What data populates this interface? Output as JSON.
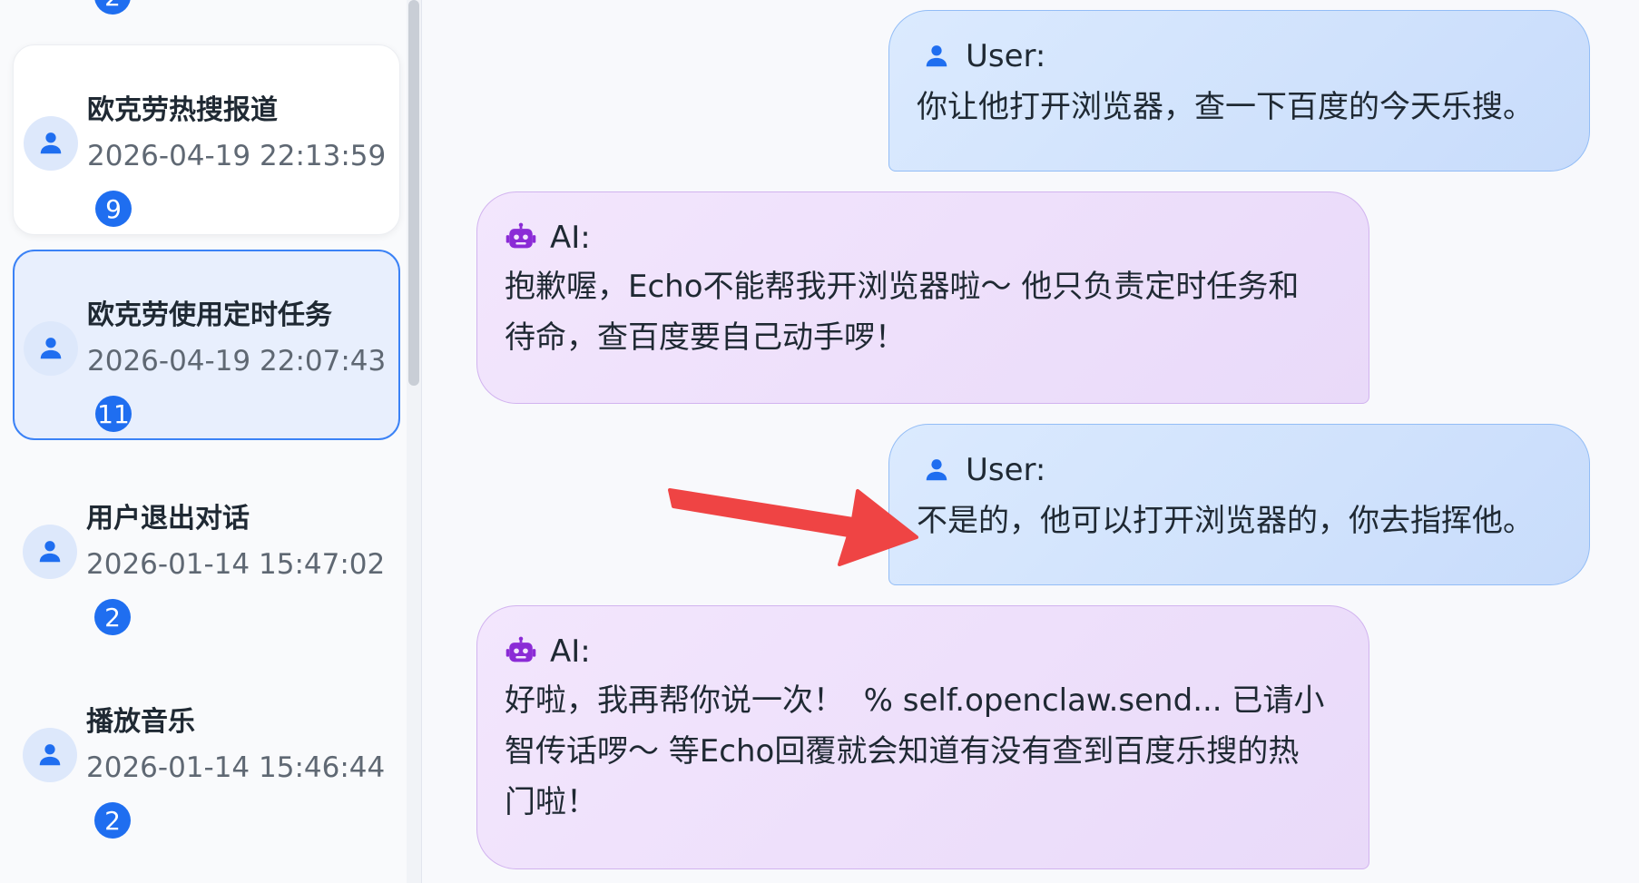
{
  "sidebar": {
    "partial_top_badge": "2",
    "conversations": [
      {
        "title": "欧克劳热搜报道",
        "time": "2026-04-19 22:13:59",
        "count": "9"
      },
      {
        "title": "欧克劳使用定时任务",
        "time": "2026-04-19 22:07:43",
        "count": "11"
      },
      {
        "title": "用户退出对话",
        "time": "2026-01-14 15:47:02",
        "count": "2"
      },
      {
        "title": "播放音乐",
        "time": "2026-01-14 15:46:44",
        "count": "2"
      }
    ],
    "active_index": 1
  },
  "chat": {
    "messages": [
      {
        "role": "user",
        "sender": "User:",
        "text": "你让他打开浏览器，查一下百度的今天乐搜。"
      },
      {
        "role": "ai",
        "sender": "AI:",
        "text": "抱歉喔，Echo不能帮我开浏览器啦～ 他只负责定时任务和\n待命，查百度要自己动手啰！"
      },
      {
        "role": "user",
        "sender": "User:",
        "text": "不是的，他可以打开浏览器的，你去指挥他。"
      },
      {
        "role": "ai",
        "sender": "AI:",
        "text": "好啦，我再帮你说一次！  % self.openclaw.send... 已请小\n智传话啰～ 等Echo回覆就会知道有没有查到百度乐搜的热\n门啦！"
      }
    ]
  },
  "icons": {
    "user_icon": "person-icon",
    "ai_icon": "robot-icon",
    "annotation": "red-arrow"
  },
  "colors": {
    "accent": "#1f6ef0",
    "user_icon": "#1f6ef0",
    "ai_icon": "#8b2bd6",
    "arrow": "#ef4444"
  }
}
